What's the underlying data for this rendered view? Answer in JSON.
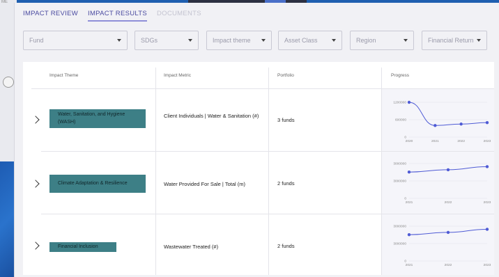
{
  "background": {
    "corner_text": "ME"
  },
  "tabs": [
    {
      "label": "IMPACT REVIEW",
      "state": "normal"
    },
    {
      "label": "IMPACT RESULTS",
      "state": "active"
    },
    {
      "label": "DOCUMENTS",
      "state": "disabled"
    }
  ],
  "filters": [
    {
      "placeholder": "Fund"
    },
    {
      "placeholder": "SDGs"
    },
    {
      "placeholder": "Impact theme"
    },
    {
      "placeholder": "Asset Class"
    },
    {
      "placeholder": "Region"
    },
    {
      "placeholder": "Financial Return"
    }
  ],
  "table": {
    "headers": [
      "Impact Theme",
      "Impact Metric",
      "Portfolio",
      "Progress"
    ],
    "rows": [
      {
        "theme": "Water, Sanitation, and Hygiene (WASH)",
        "metric": "Client Individuals | Water & Sanitation (#)",
        "portfolio": "3 funds",
        "chart_data": {
          "type": "line",
          "x": [
            "2020",
            "2021",
            "2022",
            "2023"
          ],
          "y": [
            1200000,
            400000,
            450000,
            500000
          ],
          "y_ticks": [
            "1200000",
            "600000",
            "0"
          ],
          "ylim": [
            0,
            1200000
          ],
          "color": "#4f5bd5"
        }
      },
      {
        "theme": "Climate Adaptation & Resilience",
        "metric": "Water Provided For Sale | Total (m)",
        "portfolio": "2 funds",
        "chart_data": {
          "type": "line",
          "x": [
            "2021",
            "2022",
            "2023"
          ],
          "y": [
            3400000,
            3700000,
            4100000
          ],
          "y_ticks": [
            "3000000",
            "3000000",
            "0"
          ],
          "ylim": [
            0,
            4500000
          ],
          "color": "#4f5bd5"
        }
      },
      {
        "theme": "Financial Inclusion",
        "metric": "Wastewater Treated (#)",
        "portfolio": "2 funds",
        "chart_data": {
          "type": "line",
          "x": [
            "2021",
            "2022",
            "2023"
          ],
          "y": [
            3400000,
            3700000,
            4100000
          ],
          "y_ticks": [
            "3000000",
            "3000000",
            "0"
          ],
          "ylim": [
            0,
            4500000
          ],
          "color": "#4f5bd5"
        }
      }
    ]
  }
}
